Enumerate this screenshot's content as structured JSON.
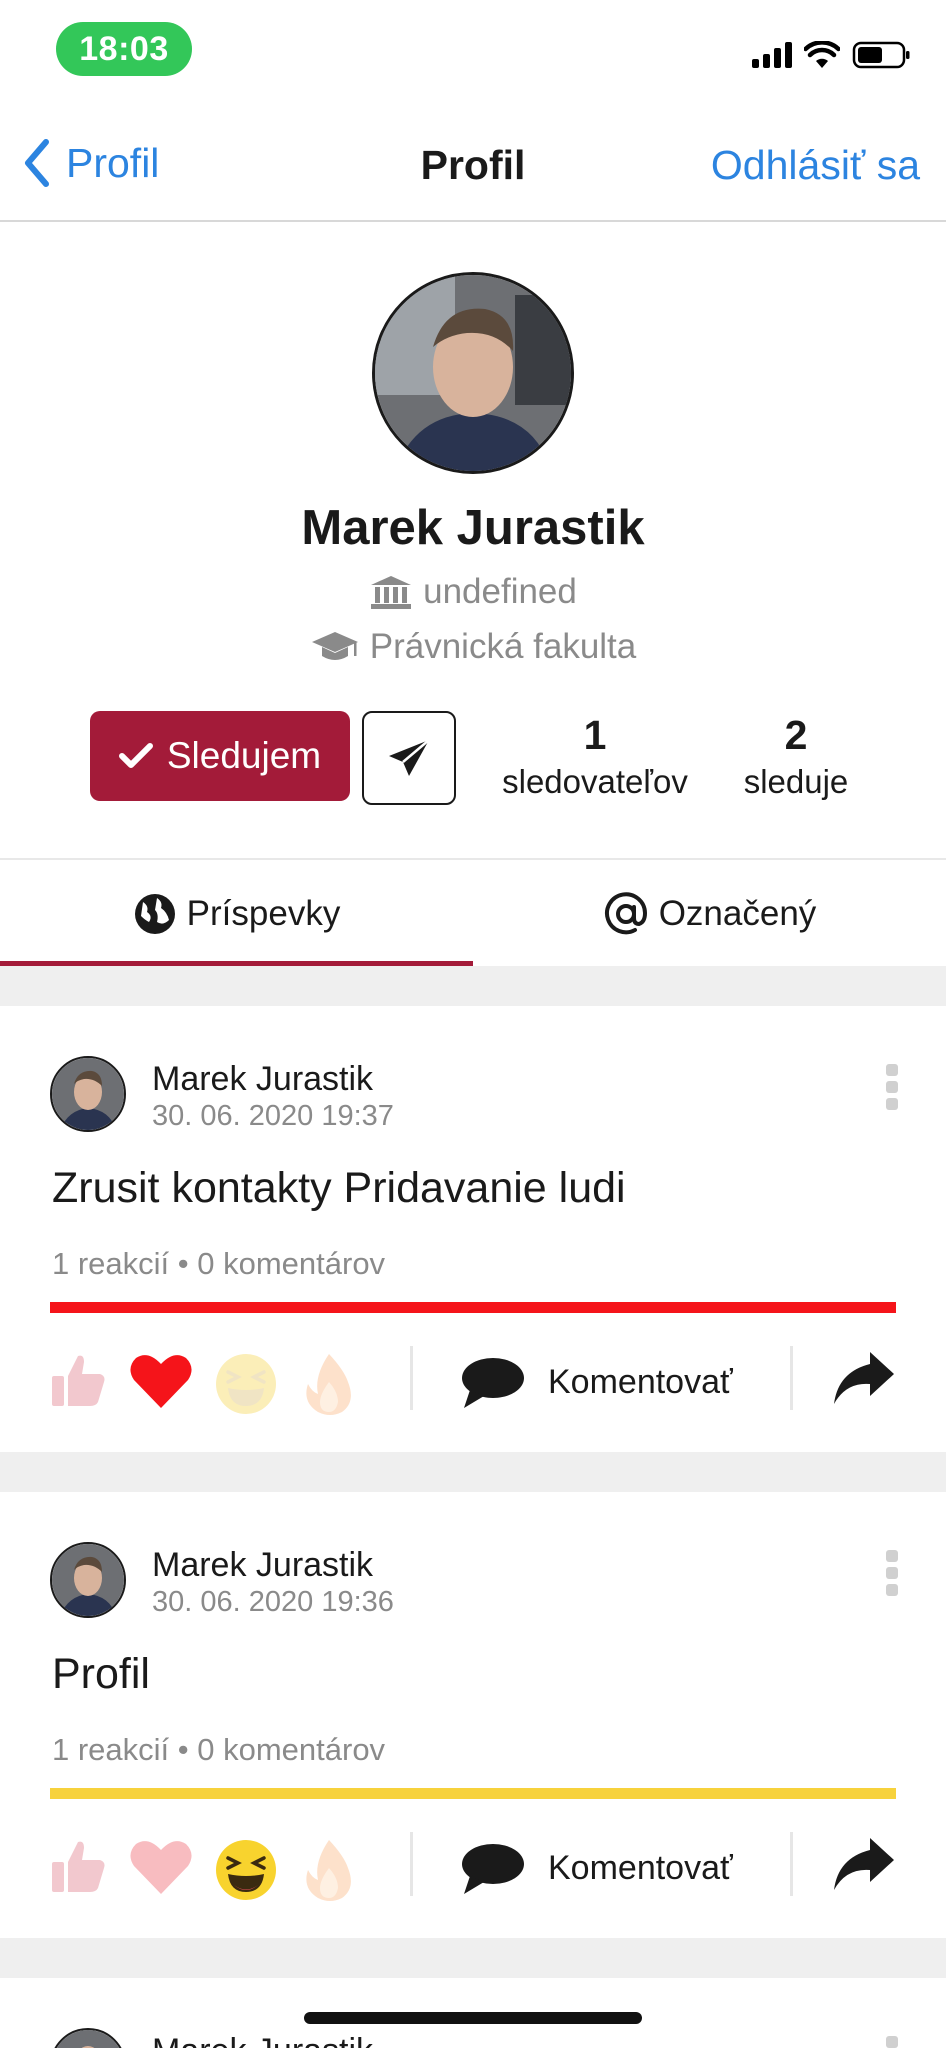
{
  "status_bar": {
    "time": "18:03"
  },
  "nav": {
    "back_label": "Profil",
    "title": "Profil",
    "logout_label": "Odhlásiť sa"
  },
  "profile": {
    "name": "Marek Jurastik",
    "institution": "undefined",
    "faculty": "Právnická fakulta",
    "follow_label": "Sledujem",
    "followers_count": "1",
    "followers_label": "sledovateľov",
    "following_count": "2",
    "following_label": "sleduje"
  },
  "tabs": [
    {
      "label": "Príspevky",
      "active": true
    },
    {
      "label": "Označený",
      "active": false
    }
  ],
  "posts": [
    {
      "author": "Marek Jurastik",
      "date": "30. 06. 2020 19:37",
      "text": "Zrusit kontakty Pridavanie ludi",
      "meta": "1 reakcií • 0 komentárov",
      "bar_color": "#f5141a",
      "active_reaction": "heart",
      "comment_label": "Komentovať"
    },
    {
      "author": "Marek Jurastik",
      "date": "30. 06. 2020 19:36",
      "text": "Profil",
      "meta": "1 reakcií • 0 komentárov",
      "bar_color": "#f7d23c",
      "active_reaction": "laugh",
      "comment_label": "Komentovať"
    },
    {
      "author": "Marek Jurastik"
    }
  ],
  "colors": {
    "accent": "#a31b39",
    "link": "#2c84e0",
    "status_green": "#33c759"
  },
  "icons": [
    "chevron-left-icon",
    "signal-icon",
    "wifi-icon",
    "battery-icon",
    "bank-icon",
    "graduation-cap-icon",
    "check-icon",
    "paper-plane-icon",
    "globe-icon",
    "at-icon",
    "like-icon",
    "heart-icon",
    "laugh-icon",
    "fire-icon",
    "comment-icon",
    "share-icon",
    "more-icon"
  ]
}
